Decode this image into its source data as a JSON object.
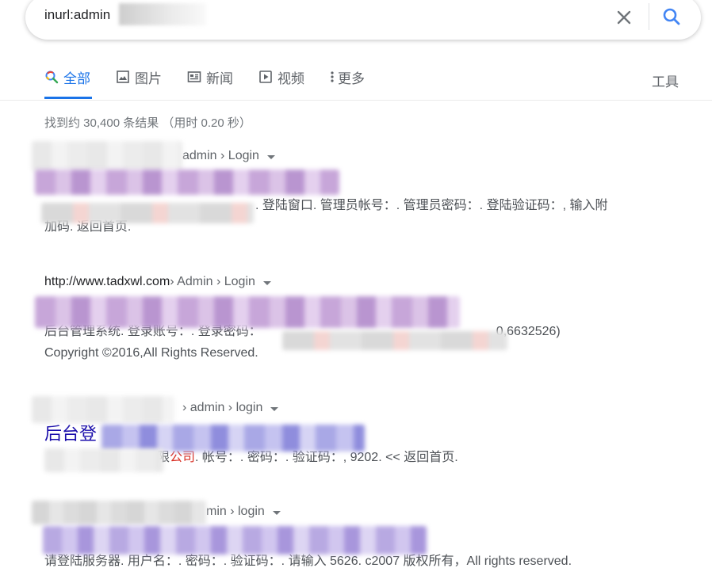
{
  "search": {
    "query": "inurl:admin"
  },
  "tabs": [
    {
      "label": "全部",
      "icon": "search-icon",
      "active": true
    },
    {
      "label": "图片",
      "icon": "image-icon",
      "active": false
    },
    {
      "label": "新闻",
      "icon": "news-icon",
      "active": false
    },
    {
      "label": "视频",
      "icon": "video-icon",
      "active": false
    },
    {
      "label": "更多",
      "icon": "more-vert-icon",
      "active": false
    }
  ],
  "tools_label": "工具",
  "stats": "找到约 30,400 条结果 （用时 0.20 秒）",
  "results": [
    {
      "cite_path": "admin › Login",
      "snippet_visible": ". 登陆窗口. 管理员帐号：. 管理员密码：. 登陆验证码：, 输入附",
      "snippet_line2": "加码. 返回首页."
    },
    {
      "cite_url": "http://www.tadxwl.com",
      "cite_path": " › Admin › Login",
      "snippet_visible": "后台管理系统. 登录账号：. 登录密码：",
      "snippet_tail": "0,6632526)",
      "snippet_line2": "Copyright ©2016,All Rights Reserved."
    },
    {
      "cite_path": "› admin › login",
      "title_visible": "后台登",
      "snippet_red": "公司",
      "snippet_prefix": "限",
      "snippet_rest": ". 帐号：. 密码：. 验证码：, 9202. << 返回首页."
    },
    {
      "cite_path": "min › login",
      "snippet_visible": "请登陆服务器. 用户名：. 密码：. 验证码：. 请输入 5626. c2007 版权所有，All rights reserved."
    }
  ],
  "colors": {
    "accent": "#1a73e8",
    "link": "#1a0dab",
    "snippet": "#4d5156",
    "highlight_red": "#d93025"
  }
}
